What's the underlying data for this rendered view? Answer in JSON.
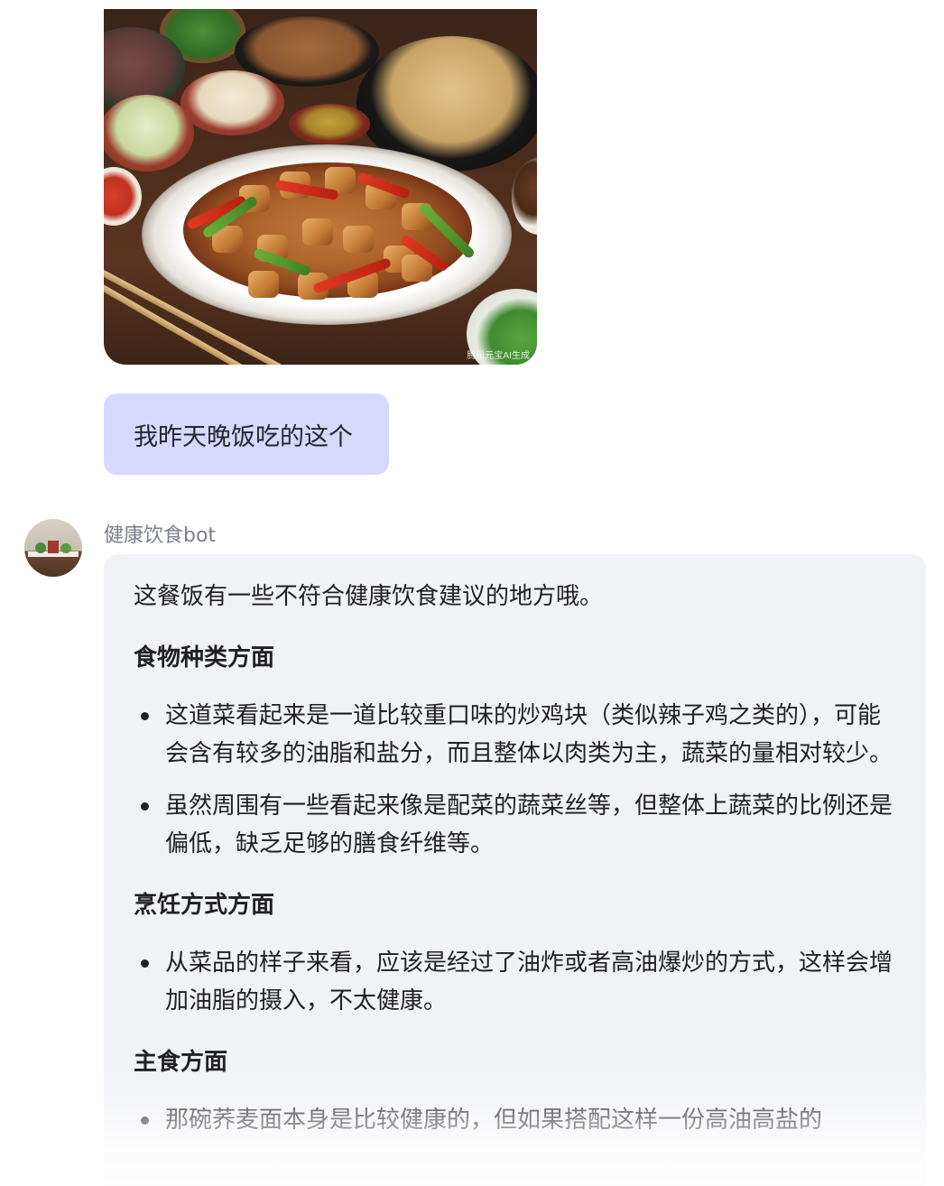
{
  "image": {
    "watermark": "腾讯元宝AI生成"
  },
  "user_message": {
    "text": "我昨天晚饭吃的这个"
  },
  "bot": {
    "name": "健康饮食bot",
    "intro": "这餐饭有一些不符合健康饮食建议的地方哦。",
    "sections": [
      {
        "heading": "食物种类方面",
        "bullets": [
          "这道菜看起来是一道比较重口味的炒鸡块（类似辣子鸡之类的），可能会含有较多的油脂和盐分，而且整体以肉类为主，蔬菜的量相对较少。",
          "虽然周围有一些看起来像是配菜的蔬菜丝等，但整体上蔬菜的比例还是偏低，缺乏足够的膳食纤维等。"
        ]
      },
      {
        "heading": "烹饪方式方面",
        "bullets": [
          "从菜品的样子来看，应该是经过了油炸或者高油爆炒的方式，这样会增加油脂的摄入，不太健康。"
        ]
      },
      {
        "heading": "主食方面",
        "bullets": [
          "那碗荞麦面本身是比较健康的，但如果搭配这样一份高油高盐的"
        ]
      }
    ]
  }
}
